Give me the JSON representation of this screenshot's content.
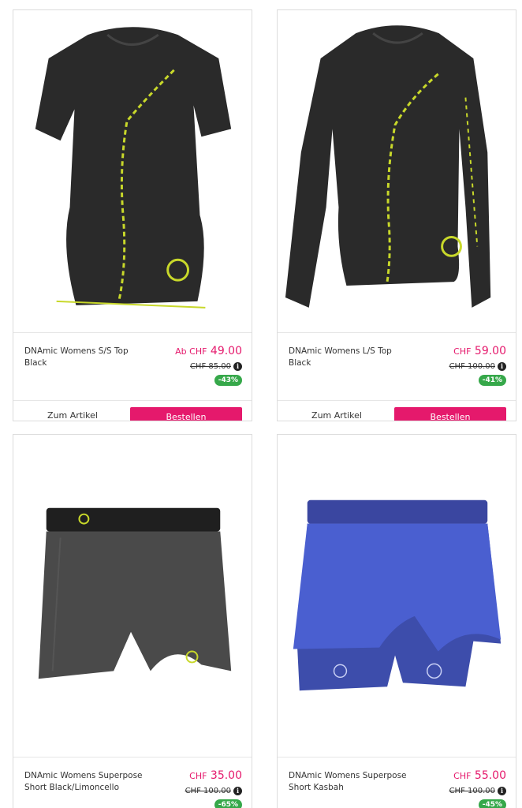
{
  "products": [
    {
      "name": "DNAmic Womens S/S Top Black",
      "price_prefix": "Ab CHF",
      "price": "49.00",
      "old_price": "CHF 85.00",
      "discount": "-43%",
      "link_label": "Zum Artikel",
      "order_label": "Bestellen",
      "image": "short-sleeve-top"
    },
    {
      "name": "DNAmic Womens L/S Top Black",
      "price_prefix": "CHF",
      "price": "59.00",
      "old_price": "CHF 100.00",
      "discount": "-41%",
      "link_label": "Zum Artikel",
      "order_label": "Bestellen",
      "image": "long-sleeve-top"
    },
    {
      "name": "DNAmic Womens Superpose Short Black/Limoncello",
      "price_prefix": "CHF",
      "price": "35.00",
      "old_price": "CHF 100.00",
      "discount": "-65%",
      "image": "black-shorts"
    },
    {
      "name": "DNAmic Womens Superpose Short Kasbah",
      "price_prefix": "CHF",
      "price": "55.00",
      "old_price": "CHF 100.00",
      "discount": "-45%",
      "image": "blue-shorts"
    }
  ],
  "colors": {
    "accent": "#e5196c",
    "discount_badge": "#36a84a",
    "border": "#dcdcdc"
  }
}
